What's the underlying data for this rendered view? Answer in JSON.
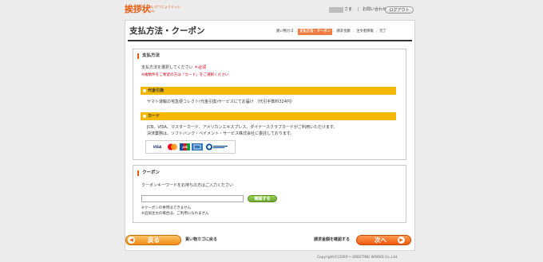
{
  "header": {
    "logo_main": "挨拶状",
    "logo_sub": "あいさつじょうドットコム",
    "user_suffix": "さま",
    "separator": "|",
    "contact": "お問い合わせ",
    "logout": "ログアウト"
  },
  "page": {
    "title": "支払方法・クーポン",
    "steps": [
      {
        "label": "買い物カゴ",
        "active": false
      },
      {
        "label": "支払方法・クーポン",
        "active": true
      },
      {
        "label": "請求金額",
        "active": false
      },
      {
        "label": "注文者情報",
        "active": false
      },
      {
        "label": "完了",
        "active": false
      }
    ],
    "step_arrow": "›"
  },
  "payment": {
    "heading": "支払方法",
    "instruction": "支払方法を選択してください",
    "required": "＊必須",
    "note": "※複数件をご希望の方は「カード」をご選択ください",
    "cod": {
      "label": "代金引換",
      "description": "ヤマト運輸の宅急便コレクト(代金引換)サービスにてお届け （代引手数料324円）"
    },
    "card": {
      "label": "カード",
      "description1": "JCB、VISA、マスターカード、アメリカンエキスプレス、ダイナースクラブカードがご利用いただけます。",
      "description2": "決済業務は、ソフトバンク・ペイメント・サービス株式会社に委託しております。",
      "brands": [
        {
          "name": "VISA",
          "icon": "visa-icon",
          "bg": "#ffffff",
          "color": "#1a1f71"
        },
        {
          "name": "",
          "icon": "mastercard-icon",
          "bg": "#ffffff",
          "color": "#eb001b"
        },
        {
          "name": "JCB",
          "icon": "jcb-icon",
          "bg": "#ffffff",
          "color": "#0b4ea2"
        },
        {
          "name": "",
          "icon": "amex-icon",
          "bg": "#2e77bc",
          "color": "#ffffff"
        },
        {
          "name": "",
          "icon": "diners-icon",
          "bg": "#ffffff",
          "color": "#004a97"
        }
      ]
    }
  },
  "coupon": {
    "heading": "クーポン",
    "instruction": "クーポンキーワードをお持ちの方はご入力ください",
    "input_value": "",
    "confirm_button": "確認する",
    "note1": "※クーポンの併用はできません",
    "note2": "※追加注文の場合は、ご利用になれません"
  },
  "footer": {
    "back_button": "戻る",
    "back_link": "買い物カゴに戻る",
    "next_link": "請求金額を確認する",
    "next_button": "次へ",
    "copyright": "Copyright(C)2003～ GREETING WORKS Co.,Ltd."
  },
  "colors": {
    "accent": "#e85a0c",
    "bar": "#f5b800",
    "active_step": "#f07c43",
    "confirm_green": "#7ab83c"
  }
}
